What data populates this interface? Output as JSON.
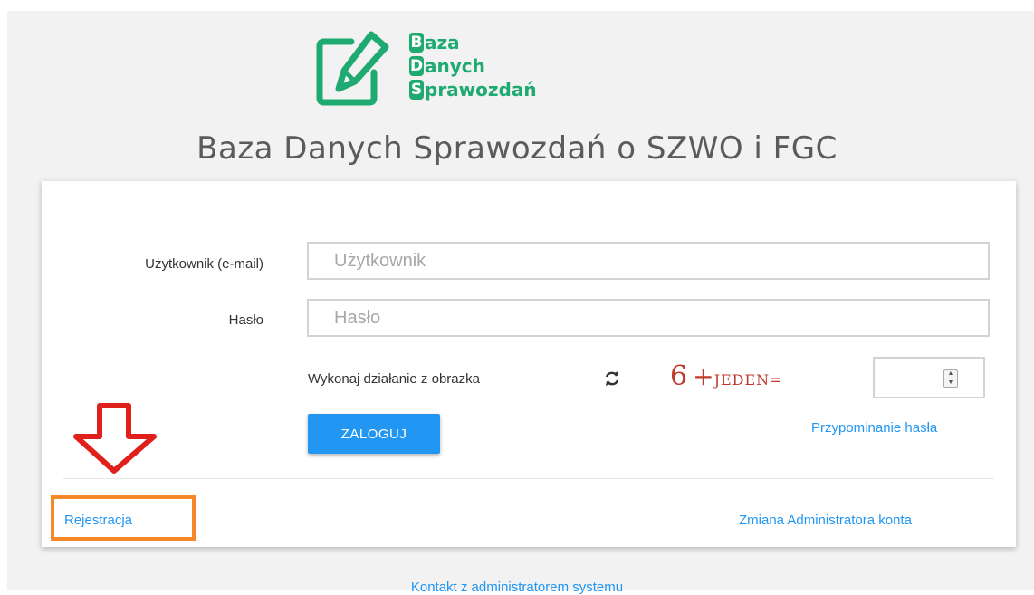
{
  "logo": {
    "letters": [
      "B",
      "D",
      "S"
    ],
    "words": [
      "aza",
      "anych",
      "prawozdań"
    ],
    "color": "#1faa72"
  },
  "page_title": "Baza Danych Sprawozdań o SZWO i FGC",
  "form": {
    "user_label": "Użytkownik (e-mail)",
    "user_placeholder": "Użytkownik",
    "user_value": "",
    "password_label": "Hasło",
    "password_placeholder": "Hasło",
    "password_value": "",
    "captcha_label": "Wykonaj działanie z obrazka",
    "captcha_number": "6",
    "captcha_plus": "+",
    "captcha_word": "JEDEN=",
    "captcha_value": "",
    "login_button": "ZALOGUJ",
    "forgot_password_link": "Przypominanie hasła"
  },
  "card_footer": {
    "register_link": "Rejestracja",
    "change_admin_link": "Zmiana Administratora konta"
  },
  "footer": {
    "contact_link": "Kontakt z administratorem systemu"
  },
  "colors": {
    "accent": "#2196f3",
    "captcha": "#c0392b",
    "highlight": "#f5892a",
    "arrow": "#e0201b"
  },
  "icons": {
    "logo": "pencil-on-note-icon",
    "refresh": "refresh-icon",
    "spinner": "number-spinner-icon",
    "annotation": "down-arrow-icon"
  }
}
